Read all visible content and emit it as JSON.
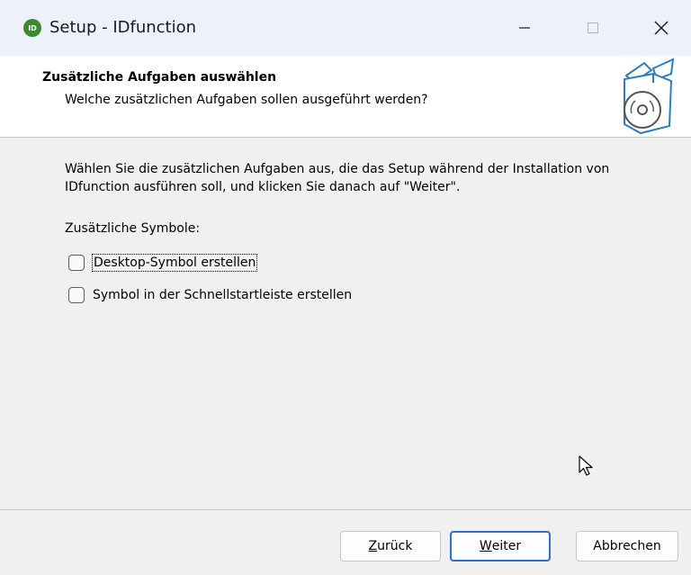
{
  "window": {
    "title": "Setup - IDfunction",
    "app_icon_text": "ID",
    "controls": [
      "minimize-icon",
      "maximize-icon",
      "close-icon"
    ]
  },
  "header": {
    "title": "Zusätzliche Aufgaben auswählen",
    "subtitle": "Welche zusätzlichen Aufgaben sollen ausgeführt werden?",
    "image_icon": "setup-box-cd-icon"
  },
  "content": {
    "description": "Wählen Sie die zusätzlichen Aufgaben aus, die das Setup während der Installation von IDfunction ausführen soll, und klicken Sie danach auf \"Weiter\".",
    "section_label": "Zusätzliche Symbole:",
    "tasks": [
      {
        "label": "Desktop-Symbol erstellen",
        "checked": false,
        "focused": true
      },
      {
        "label": "Symbol in der Schnellstartleiste erstellen",
        "checked": false,
        "focused": false
      }
    ]
  },
  "buttons": {
    "back_prefix": "",
    "back_accel": "Z",
    "back_rest": "urück",
    "next_accel": "W",
    "next_rest": "eiter",
    "cancel": "Abbrechen"
  },
  "colors": {
    "default_button_border": "#2a6fd6",
    "app_icon": "#3b8a2f",
    "header_bg": "#ffffff",
    "dialog_bg": "#f0f0f0"
  }
}
